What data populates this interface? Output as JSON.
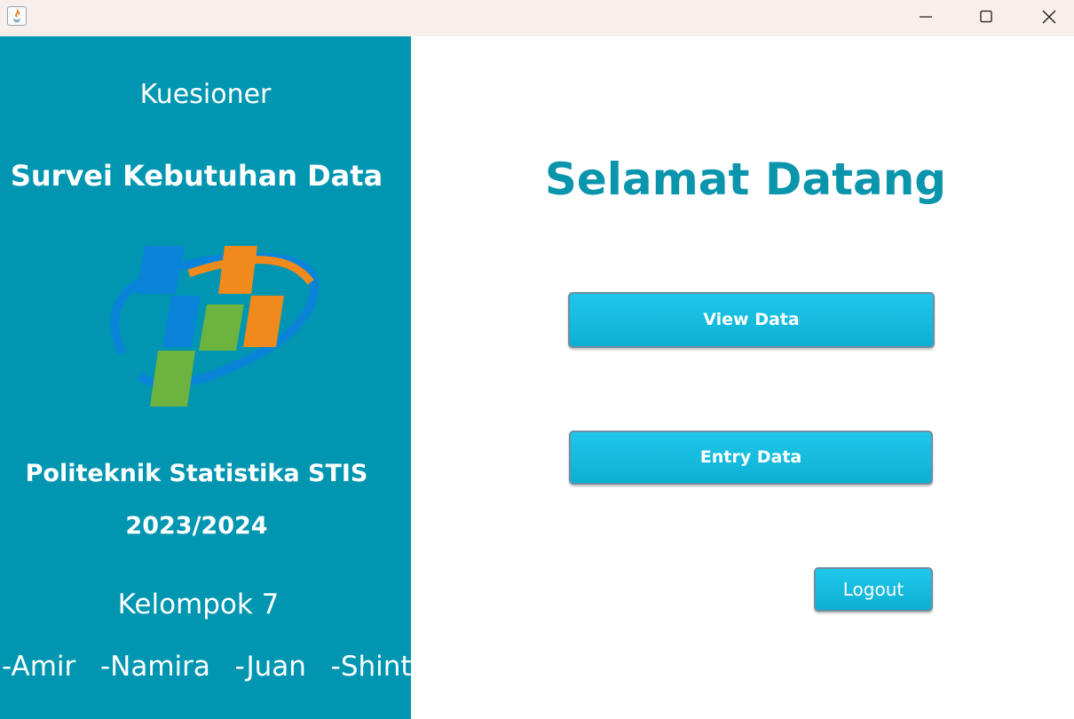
{
  "titlebar": {
    "app_icon": "java-icon",
    "minimize_icon": "minimize-icon",
    "maximize_icon": "maximize-icon",
    "close_icon": "close-icon"
  },
  "sidebar": {
    "kuesioner": "Kuesioner",
    "survey_title": "Survei Kebutuhan Data",
    "logo": "bps-logo",
    "institution": "Politeknik Statistika STIS",
    "year": "2023/2024",
    "group": "Kelompok 7",
    "members": "-Amir  -Namira  -Juan  -Shinta",
    "background_color": "#0096b1"
  },
  "main": {
    "welcome": "Selamat Datang",
    "view_data_label": "View Data",
    "entry_data_label": "Entry Data",
    "logout_label": "Logout",
    "accent_color": "#0a95ad",
    "button_color": "#14bddf"
  }
}
